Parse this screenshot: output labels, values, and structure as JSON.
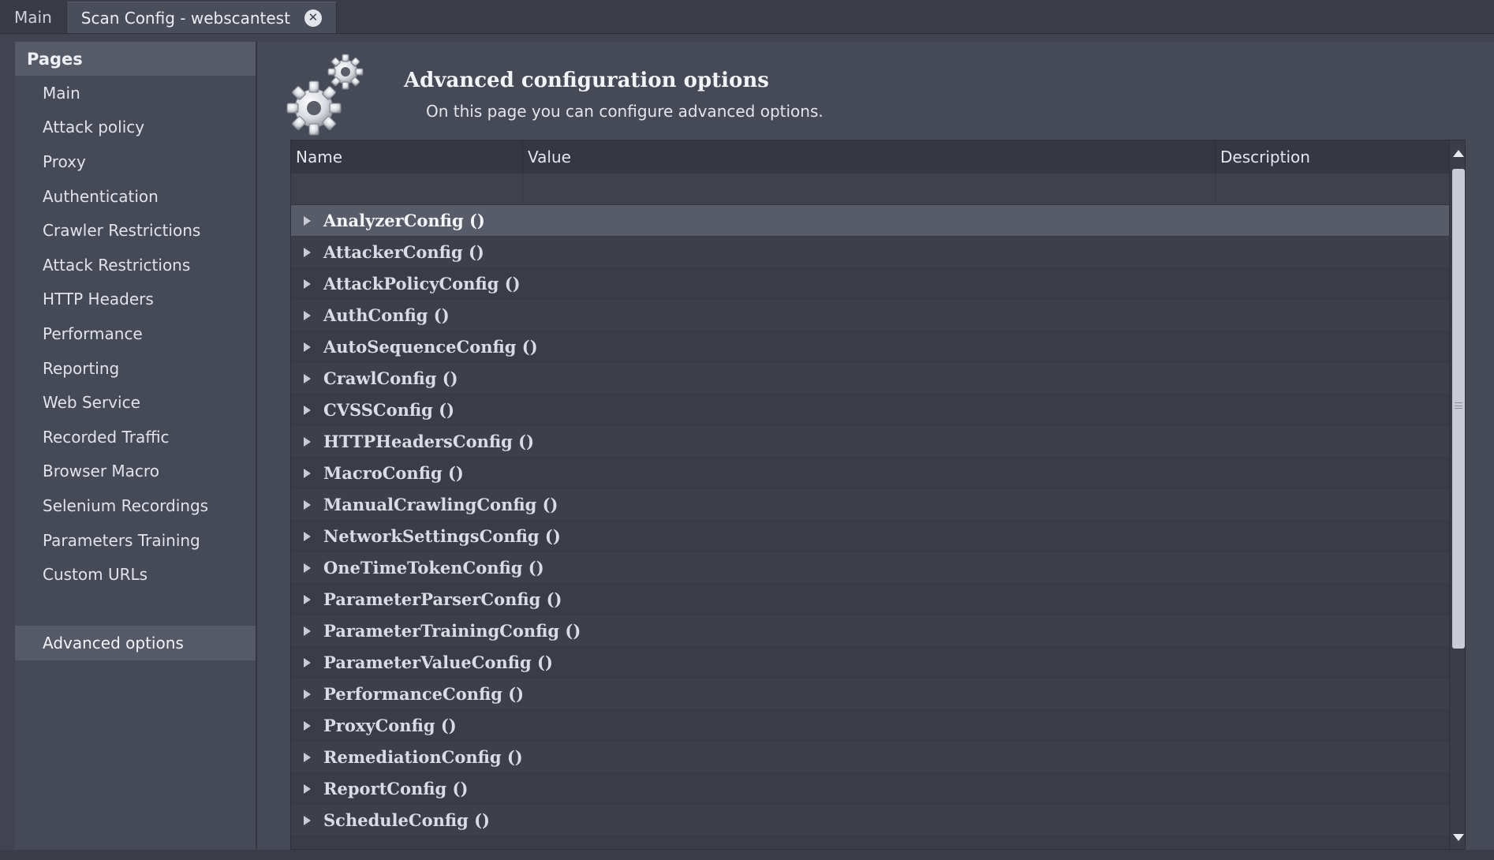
{
  "tabs": [
    {
      "label": "Main"
    },
    {
      "label": "Scan Config - webscantest"
    }
  ],
  "sidebar": {
    "header": "Pages",
    "items": [
      {
        "label": "Main"
      },
      {
        "label": "Attack policy"
      },
      {
        "label": "Proxy"
      },
      {
        "label": "Authentication"
      },
      {
        "label": "Crawler Restrictions"
      },
      {
        "label": "Attack Restrictions"
      },
      {
        "label": "HTTP Headers"
      },
      {
        "label": "Performance"
      },
      {
        "label": "Reporting"
      },
      {
        "label": "Web Service"
      },
      {
        "label": "Recorded Traffic"
      },
      {
        "label": "Browser Macro"
      },
      {
        "label": "Selenium Recordings"
      },
      {
        "label": "Parameters Training"
      },
      {
        "label": "Custom URLs"
      }
    ],
    "selected_item": {
      "label": "Advanced options"
    }
  },
  "page": {
    "title": "Advanced configuration options",
    "subtitle": "On this page you can configure advanced options."
  },
  "table": {
    "columns": [
      {
        "label": "Name"
      },
      {
        "label": "Value"
      },
      {
        "label": "Description"
      }
    ],
    "rows": [
      {
        "name": "AnalyzerConfig ()"
      },
      {
        "name": "AttackerConfig ()"
      },
      {
        "name": "AttackPolicyConfig ()"
      },
      {
        "name": "AuthConfig ()"
      },
      {
        "name": "AutoSequenceConfig ()"
      },
      {
        "name": "CrawlConfig ()"
      },
      {
        "name": "CVSSConfig ()"
      },
      {
        "name": "HTTPHeadersConfig ()"
      },
      {
        "name": "MacroConfig ()"
      },
      {
        "name": "ManualCrawlingConfig ()"
      },
      {
        "name": "NetworkSettingsConfig ()"
      },
      {
        "name": "OneTimeTokenConfig ()"
      },
      {
        "name": "ParameterParserConfig ()"
      },
      {
        "name": "ParameterTrainingConfig ()"
      },
      {
        "name": "ParameterValueConfig ()"
      },
      {
        "name": "PerformanceConfig ()"
      },
      {
        "name": "ProxyConfig ()"
      },
      {
        "name": "RemediationConfig ()"
      },
      {
        "name": "ReportConfig ()"
      },
      {
        "name": "ScheduleConfig ()"
      }
    ]
  },
  "icons": {
    "tab_close": "close-circle-icon",
    "page_header": "gears-icon",
    "row_expander": "triangle-right-icon"
  },
  "colors": {
    "background": "#414450",
    "panel": "#464a56",
    "selected": "#565a67",
    "table_bg": "#3a3d48"
  }
}
